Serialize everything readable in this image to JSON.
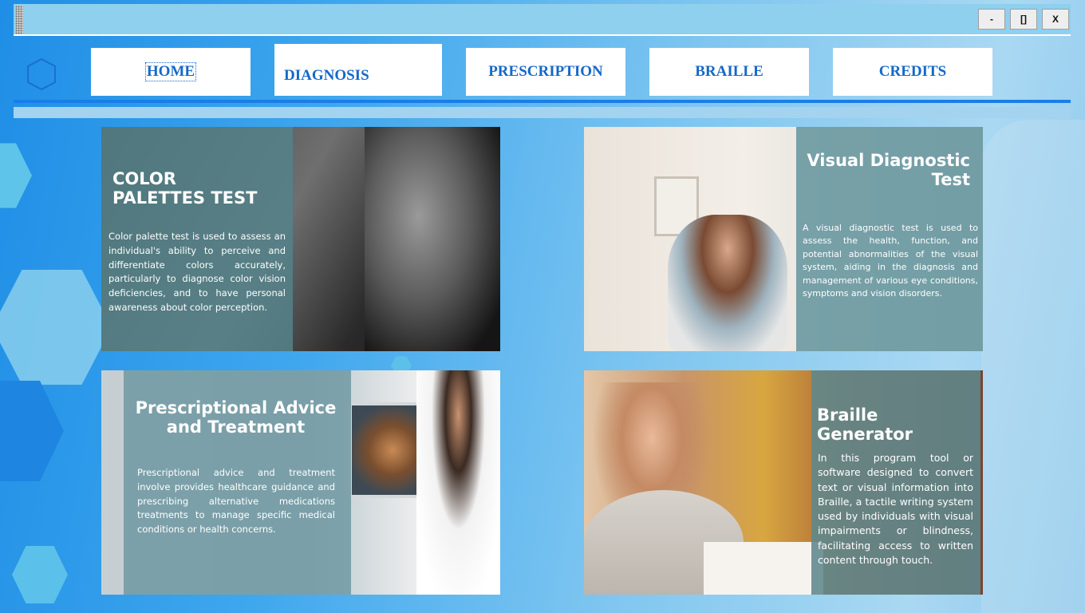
{
  "window": {
    "minimize_label": "-",
    "maximize_label": "[]",
    "close_label": "X"
  },
  "nav": {
    "items": [
      {
        "label": "HOME",
        "active": true
      },
      {
        "label": "DIAGNOSIS",
        "active": false
      },
      {
        "label": "PRESCRIPTION",
        "active": false
      },
      {
        "label": "BRAILLE",
        "active": false
      },
      {
        "label": "CREDITS",
        "active": false
      }
    ]
  },
  "cards": {
    "color_palettes": {
      "title_line1": "COLOR",
      "title_line2": "PALETTES TEST",
      "description": "Color palette test is used to assess an individual's ability to perceive and differentiate colors accurately, particularly to diagnose color vision deficiencies, and to have personal awareness about color perception."
    },
    "visual_diagnostic": {
      "title_line1": "Visual Diagnostic",
      "title_line2": "Test",
      "description": "A visual diagnostic test is used to assess the health, function, and potential abnormalities of the visual system, aiding in the diagnosis and management of various eye conditions, symptoms and vision disorders."
    },
    "prescriptional": {
      "title_line1": "Prescriptional Advice",
      "title_line2": "and Treatment",
      "description": "Prescriptional advice and treatment involve provides healthcare guidance and prescribing alternative medications treatments to manage specific medical conditions or health concerns."
    },
    "braille": {
      "title_line1": "Braille Generator",
      "description": "In this program tool or software designed to convert text or visual information into Braille, a tactile writing system used by individuals with visual impairments or blindness, facilitating access to written content through touch."
    }
  },
  "colors": {
    "accent": "#1568c8",
    "nav_bg": "#ffffff",
    "rule": "#1a7ee8",
    "titlebar": "#8fd0ee",
    "panel_teal": "#5f8c93"
  },
  "icons": {
    "logo": "hexagon-logo-icon",
    "grip": "drag-grip-icon"
  }
}
